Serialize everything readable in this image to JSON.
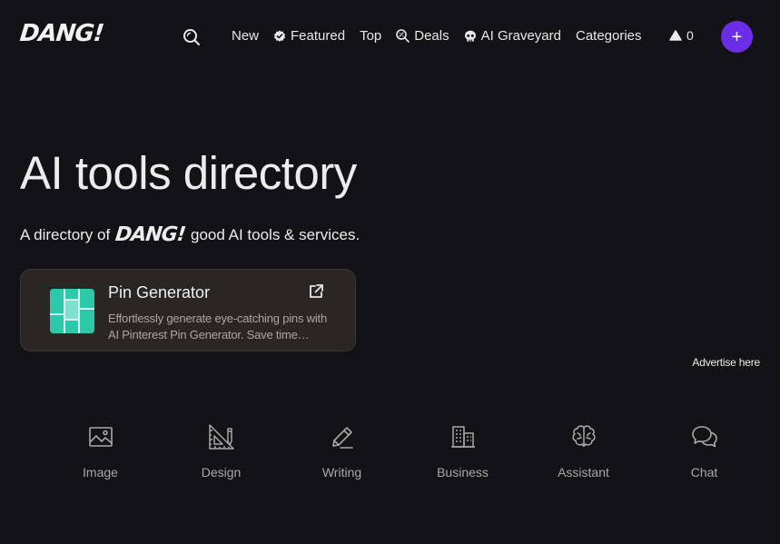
{
  "brand": {
    "logo": "DANG!"
  },
  "nav": {
    "search_icon": "search-icon",
    "items": [
      {
        "label": "New",
        "icon": ""
      },
      {
        "label": "Featured",
        "icon": "badge-check-icon"
      },
      {
        "label": "Top",
        "icon": ""
      },
      {
        "label": "Deals",
        "icon": "discount-search-icon"
      },
      {
        "label": "AI Graveyard",
        "icon": "skull-icon"
      },
      {
        "label": "Categories",
        "icon": ""
      }
    ],
    "votes": {
      "icon": "triangle-up-icon",
      "count": "0"
    },
    "add_button": {
      "label": "+"
    }
  },
  "hero": {
    "title": "AI tools directory",
    "subtitle_before": "A directory of",
    "subtitle_logo": "DANG!",
    "subtitle_after": "good AI tools & services."
  },
  "featured": {
    "title": "Pin Generator",
    "description": "Effortlessly generate eye-catching pins with AI Pinterest Pin Generator. Save time creating beautiful pins.",
    "logo_color": "#2bc8a9",
    "external_icon": "external-link-icon"
  },
  "advertise": {
    "label": "Advertise here"
  },
  "categories": [
    {
      "label": "Image",
      "icon": "image-icon"
    },
    {
      "label": "Design",
      "icon": "ruler-pencil-icon"
    },
    {
      "label": "Writing",
      "icon": "pencil-icon"
    },
    {
      "label": "Business",
      "icon": "building-icon"
    },
    {
      "label": "Assistant",
      "icon": "brain-icon"
    },
    {
      "label": "Chat",
      "icon": "chat-bubbles-icon"
    }
  ],
  "colors": {
    "background": "#131317",
    "accent": "#6b2ee6",
    "card": "#2a2624"
  }
}
